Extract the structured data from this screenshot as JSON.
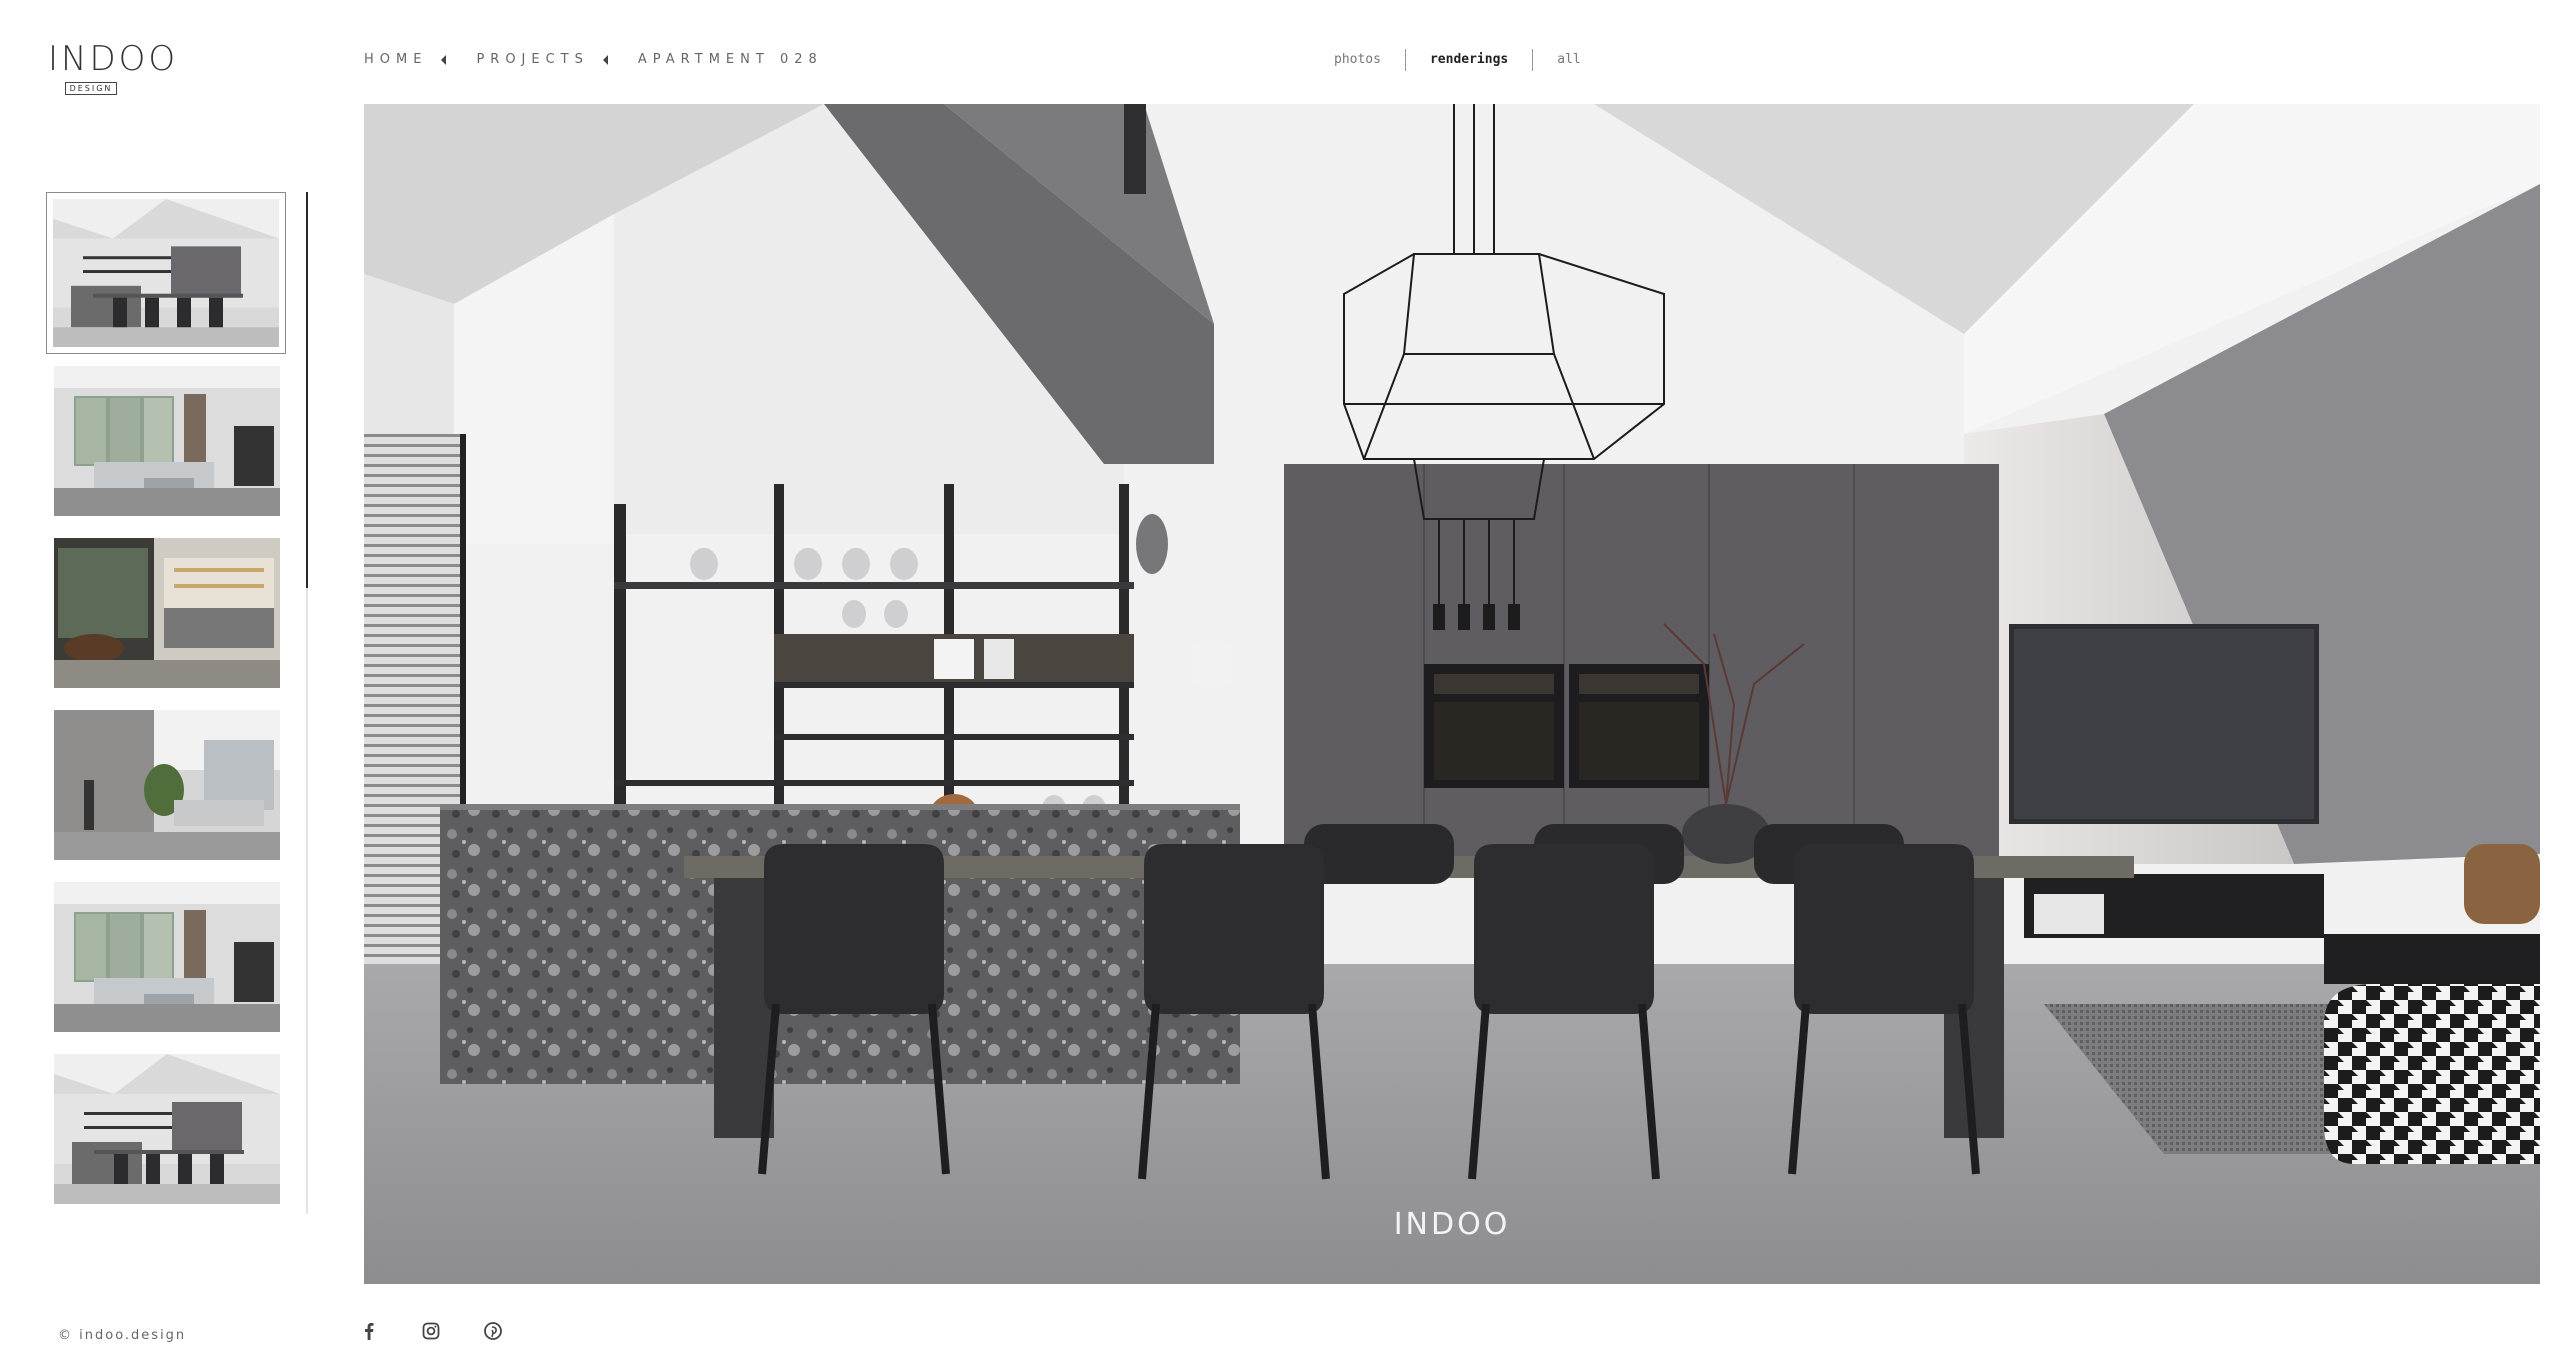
{
  "brand": {
    "logo_text": "INDOO",
    "logo_sub": "DESIGN"
  },
  "breadcrumb": {
    "items": [
      "HOME",
      "PROJECTS",
      "APARTMENT 028"
    ]
  },
  "filters": {
    "tabs": [
      "photos",
      "renderings",
      "all"
    ],
    "active": "renderings"
  },
  "gallery": {
    "thumbnails": [
      {
        "scene": "dining-kitchen",
        "selected": true
      },
      {
        "scene": "living-room-windows",
        "selected": false
      },
      {
        "scene": "kitchen-island-dark",
        "selected": false
      },
      {
        "scene": "living-room-concrete",
        "selected": false
      },
      {
        "scene": "living-room-windows",
        "selected": false
      },
      {
        "scene": "dining-kitchen",
        "selected": false
      }
    ],
    "main_watermark": "INDOO"
  },
  "footer": {
    "copyright": "© indoo.design"
  },
  "social": {
    "icons": [
      "facebook-icon",
      "instagram-icon",
      "pinterest-icon"
    ]
  },
  "colors": {
    "accent": "#2a2a2a",
    "text": "#666666",
    "cabinet": "#5f5d62",
    "marble": "#6c6c6e"
  }
}
